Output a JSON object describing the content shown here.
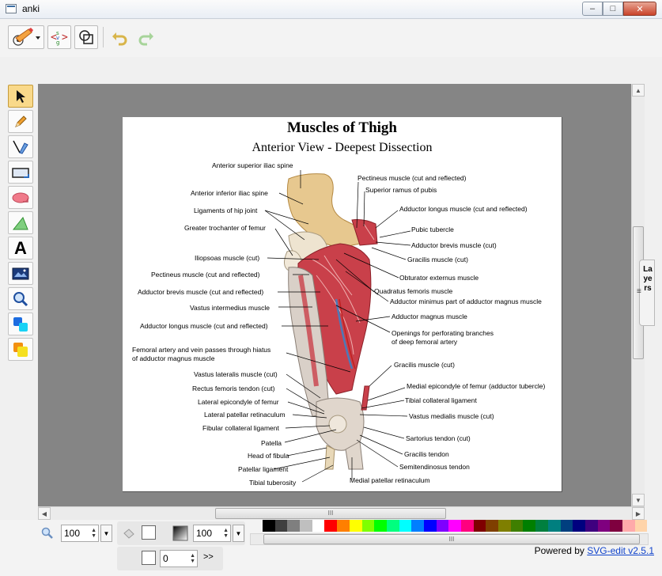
{
  "window": {
    "title": "anki",
    "min": "–",
    "max": "□",
    "close": "✕"
  },
  "toolbar": {
    "main_menu_icon": "paintbrush-menu-icon",
    "source_icon": "svg-source-icon",
    "wireframe_icon": "wireframe-icon",
    "undo_icon": "undo-icon",
    "redo_icon": "redo-icon"
  },
  "tools": [
    "select-tool",
    "pencil-tool",
    "path-tool",
    "rect-tool",
    "ellipse-tool",
    "path-shape-tool",
    "text-tool",
    "image-tool",
    "zoom-tool",
    "color-swap-tool",
    "shapelib-tool"
  ],
  "text_tool_glyph": "A",
  "drawing": {
    "title": "Muscles of Thigh",
    "subtitle": "Anterior View - Deepest Dissection",
    "labels_left": [
      "Anterior superior iliac spine",
      "Anterior inferior iliac spine",
      "Ligaments of hip joint",
      "Greater trochanter of femur",
      "Iliopsoas muscle (cut)",
      "Pectineus muscle (cut and reflected)",
      "Adductor brevis muscle (cut and reflected)",
      "Vastus intermedius muscle",
      "Adductor longus muscle (cut and reflected)",
      "Femoral artery and vein passes through hiatus",
      "of adductor magnus muscle",
      "Vastus lateralis muscle (cut)",
      "Rectus femoris tendon (cut)",
      "Lateral epicondyle of femur",
      "Lateral patellar retinaculum",
      "Fibular collateral ligament",
      "Patella",
      "Head of fibula",
      "Patellar ligament",
      "Tibial tuberosity"
    ],
    "labels_right": [
      "Pectineus muscle (cut and reflected)",
      "Superior ramus of pubis",
      "Adductor longus muscle (cut and reflected)",
      "Pubic tubercle",
      "Adductor brevis muscle (cut)",
      "Gracilis muscle (cut)",
      "Obturator externus muscle",
      "Quadratus femoris muscle",
      "Adductor minimus part of adductor magnus muscle",
      "Adductor magnus muscle",
      "Openings for perforating branches",
      "of deep femoral artery",
      "Gracilis muscle (cut)",
      "Medial epicondyle of femur (adductor tubercle)",
      "Tibial collateral ligament",
      "Vastus medialis muscle (cut)",
      "Sartorius tendon (cut)",
      "Gracilis tendon",
      "Semitendinosus tendon",
      "Medial patellar retinaculum"
    ]
  },
  "layers": {
    "label": "Layers",
    "grip": "≡"
  },
  "scroll": {
    "grip": "III"
  },
  "bottom": {
    "zoom_value": "100",
    "opacity_value": "100",
    "stroke_width": "0",
    "more": ">>",
    "powered_by": "Powered by",
    "powered_link": "SVG-edit v2.5.1"
  },
  "palette": [
    "#000000",
    "#3f3f3f",
    "#7f7f7f",
    "#bfbfbf",
    "#ffffff",
    "#ff0000",
    "#ff7f00",
    "#ffff00",
    "#7fff00",
    "#00ff00",
    "#00ff7f",
    "#00ffff",
    "#007fff",
    "#0000ff",
    "#7f00ff",
    "#ff00ff",
    "#ff007f",
    "#7f0000",
    "#7f3f00",
    "#7f7f00",
    "#3f7f00",
    "#007f00",
    "#007f3f",
    "#007f7f",
    "#003f7f",
    "#00007f",
    "#3f007f",
    "#7f007f",
    "#7f003f",
    "#ffaaaa",
    "#ffd4aa"
  ]
}
